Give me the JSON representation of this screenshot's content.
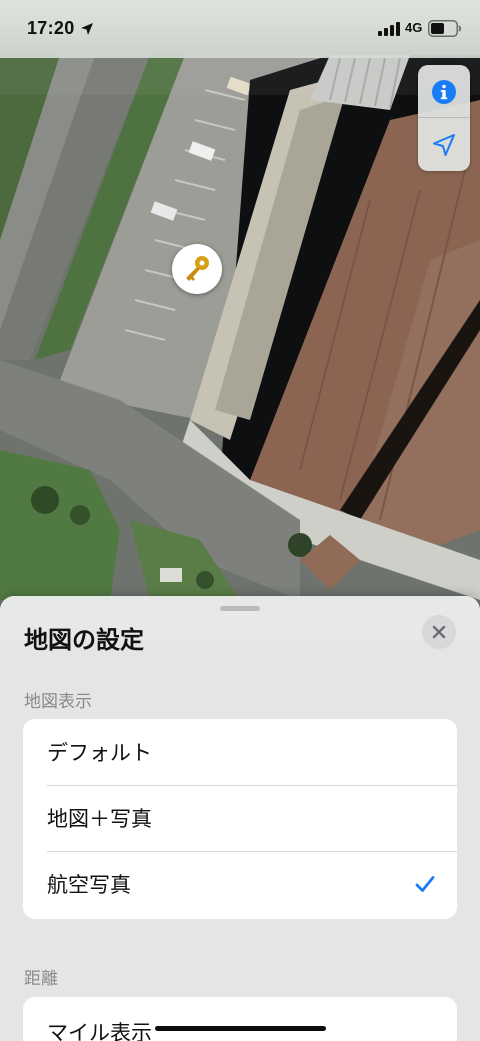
{
  "status_bar": {
    "time": "17:20",
    "network": "4G"
  },
  "map": {
    "controls": [
      {
        "icon": "info-icon"
      },
      {
        "icon": "location-arrow-icon"
      }
    ],
    "pin_icon": "key-icon"
  },
  "sheet": {
    "title": "地図の設定",
    "map_type_section": {
      "label": "地図表示",
      "options": [
        {
          "label": "デフォルト",
          "selected": false
        },
        {
          "label": "地図＋写真",
          "selected": false
        },
        {
          "label": "航空写真",
          "selected": true
        }
      ]
    },
    "distance_section": {
      "label": "距離",
      "options": [
        {
          "label": "マイル表示"
        }
      ]
    }
  },
  "colors": {
    "accent": "#1a7cf5",
    "key_gold": "#d8a019"
  }
}
